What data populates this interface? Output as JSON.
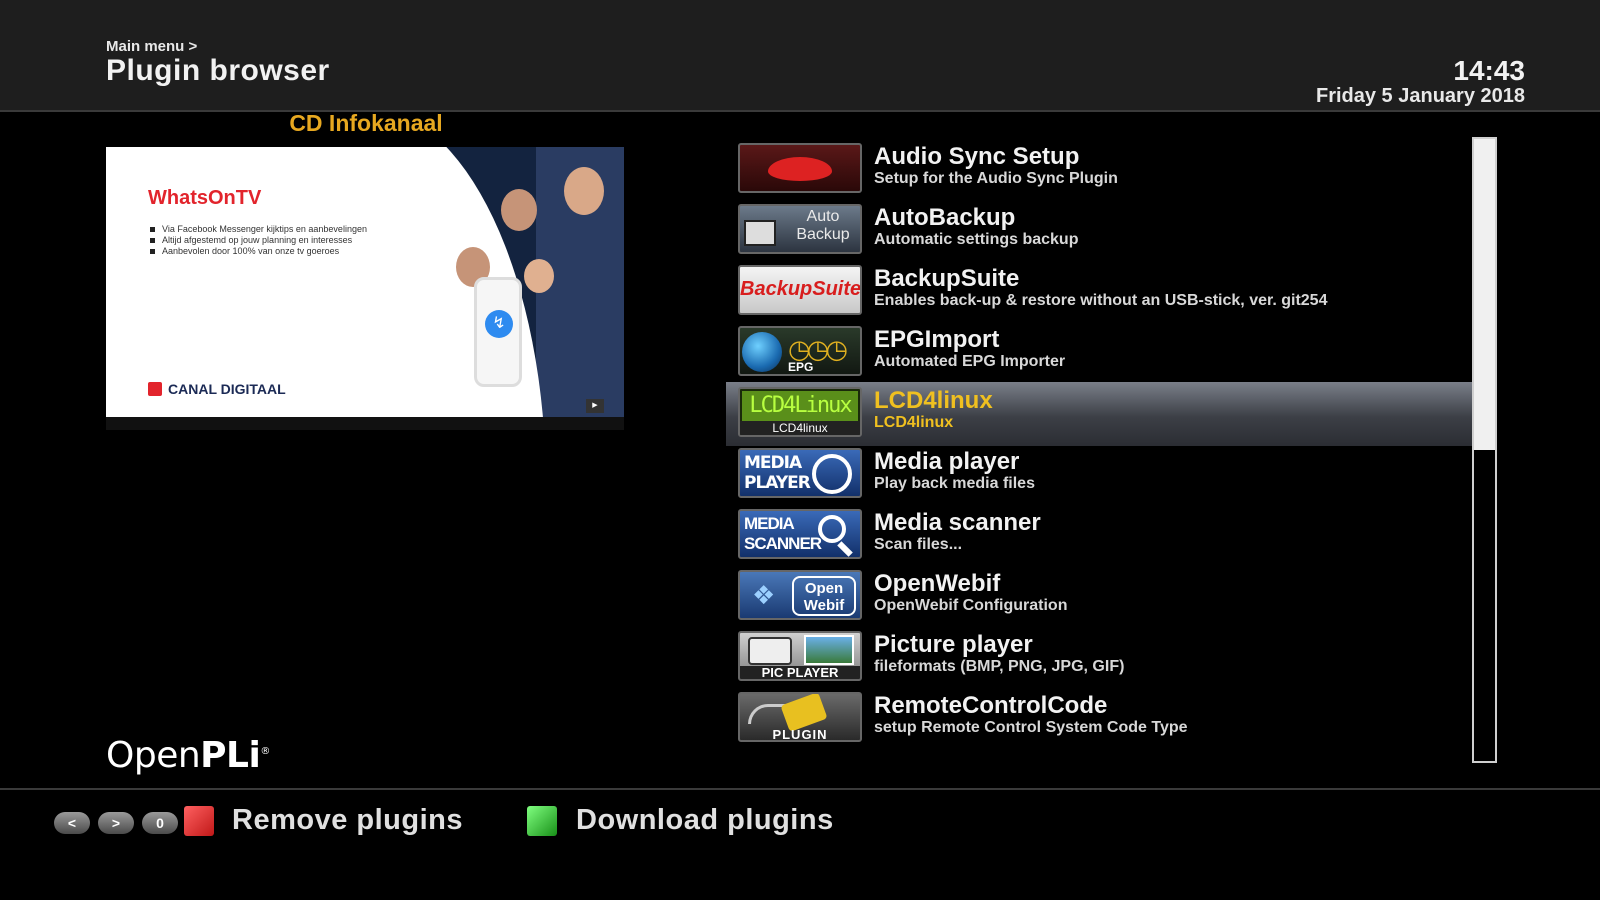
{
  "header": {
    "breadcrumb": "Main menu >",
    "title": "Plugin browser",
    "time": "14:43",
    "date": "Friday  5 January 2018"
  },
  "preview": {
    "channel_name": "CD Infokanaal",
    "promo_title": "WhatsOnTV",
    "bullets": [
      "Via Facebook Messenger kijktips en aanbevelingen",
      "Altijd afgestemd op jouw planning en interesses",
      "Aanbevolen door 100% van onze tv goeroes"
    ],
    "brand": "CANAL DIGITAAL"
  },
  "logo": {
    "text_a": "Open",
    "text_b": "PLi"
  },
  "plugins": [
    {
      "name": "Audio Sync Setup",
      "desc": "Setup for the Audio Sync Plugin",
      "icon": "lips-icon"
    },
    {
      "name": "AutoBackup",
      "desc": "Automatic settings backup",
      "icon": "auto-backup-icon",
      "icon_text": "Auto Backup"
    },
    {
      "name": "BackupSuite",
      "desc": "Enables back-up & restore without an USB-stick, ver. git254",
      "icon": "backupsuite-icon",
      "icon_text": "BackupSuite"
    },
    {
      "name": "EPGImport",
      "desc": "Automated EPG Importer",
      "icon": "epg-globe-icon",
      "icon_text": "EPG"
    },
    {
      "name": "LCD4linux",
      "desc": "LCD4linux",
      "icon": "lcd4linux-icon",
      "icon_text": "LCD4linux",
      "icon_screen": "LCD4Linux"
    },
    {
      "name": "Media player",
      "desc": "Play back media files",
      "icon": "media-player-icon",
      "icon_text": "MEDIA PLAYER"
    },
    {
      "name": "Media scanner",
      "desc": "Scan files...",
      "icon": "media-scanner-icon",
      "icon_text": "MEDIA SCANNER"
    },
    {
      "name": "OpenWebif",
      "desc": "OpenWebif Configuration",
      "icon": "openwebif-icon",
      "icon_text": "Open Webif"
    },
    {
      "name": "Picture player",
      "desc": "fileformats (BMP, PNG, JPG, GIF)",
      "icon": "pic-player-icon",
      "icon_text": "PIC PLAYER"
    },
    {
      "name": "RemoteControlCode",
      "desc": "setup Remote Control System Code Type",
      "icon": "plugin-icon",
      "icon_text": "PLUGIN"
    }
  ],
  "selected_index": 4,
  "scroll_position": 0.5,
  "footer": {
    "keys": [
      "<",
      ">",
      "0"
    ],
    "red_label": "Remove plugins",
    "green_label": "Download plugins"
  },
  "colors": {
    "accent": "#f0c020",
    "channel_name": "#e7a820",
    "red_key": "#d82020",
    "green_key": "#28b028"
  }
}
